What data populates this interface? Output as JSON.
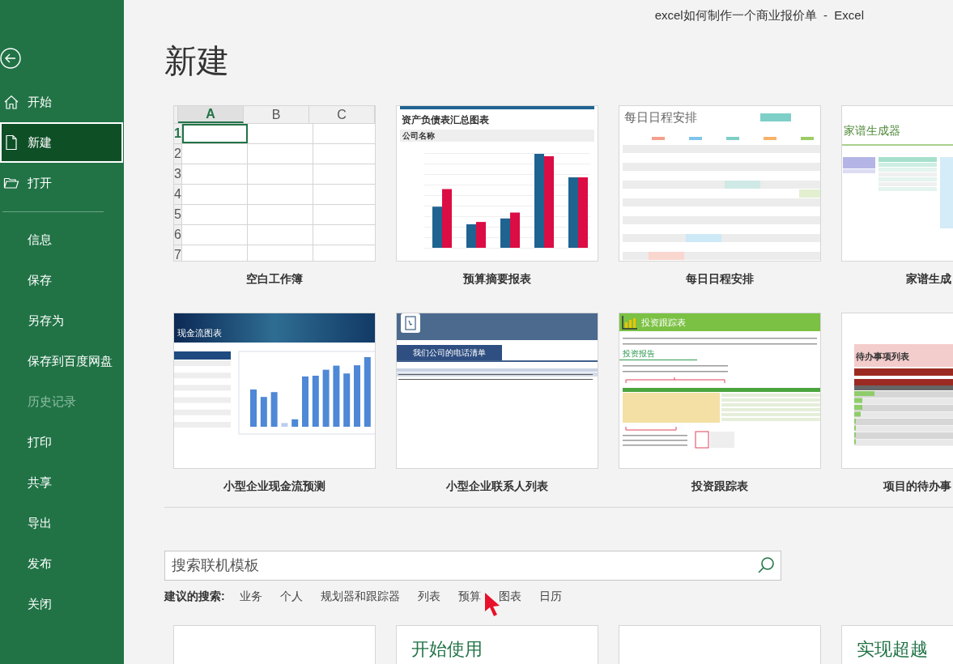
{
  "window": {
    "title": "excel如何制作一个商业报价单  -  Excel"
  },
  "sidebar": {
    "items": [
      {
        "label": "开始",
        "kind": "home",
        "selected": false,
        "disabled": false
      },
      {
        "label": "新建",
        "kind": "new",
        "selected": true,
        "disabled": false
      },
      {
        "label": "打开",
        "kind": "open",
        "selected": false,
        "disabled": false
      },
      {
        "kind": "separator"
      },
      {
        "label": "信息",
        "kind": "plain",
        "selected": false,
        "disabled": false
      },
      {
        "label": "保存",
        "kind": "plain",
        "selected": false,
        "disabled": false
      },
      {
        "label": "另存为",
        "kind": "plain",
        "selected": false,
        "disabled": false
      },
      {
        "label": "保存到百度网盘",
        "kind": "plain",
        "selected": false,
        "disabled": false
      },
      {
        "label": "历史记录",
        "kind": "plain",
        "selected": false,
        "disabled": true
      },
      {
        "label": "打印",
        "kind": "plain",
        "selected": false,
        "disabled": false
      },
      {
        "label": "共享",
        "kind": "plain",
        "selected": false,
        "disabled": false
      },
      {
        "label": "导出",
        "kind": "plain",
        "selected": false,
        "disabled": false
      },
      {
        "label": "发布",
        "kind": "plain",
        "selected": false,
        "disabled": false
      },
      {
        "label": "关闭",
        "kind": "plain",
        "selected": false,
        "disabled": false
      }
    ]
  },
  "heading": "新建",
  "templates": [
    {
      "kind": "blank",
      "label": "空白工作簿",
      "columns": [
        {
          "label": "A",
          "selected": true
        },
        {
          "label": "B",
          "selected": false
        },
        {
          "label": "C",
          "selected": false
        }
      ],
      "rows": [
        {
          "label": "1",
          "selected": true
        },
        {
          "label": "2",
          "selected": false
        },
        {
          "label": "3",
          "selected": false
        },
        {
          "label": "4",
          "selected": false
        },
        {
          "label": "5",
          "selected": false
        },
        {
          "label": "6",
          "selected": false
        },
        {
          "label": "7",
          "selected": false
        }
      ]
    },
    {
      "kind": "budget",
      "label": "预算摘要报表",
      "title": "资产负债表汇总图表",
      "subtitle": "公司名称"
    },
    {
      "kind": "schedule",
      "label": "每日日程安排",
      "title": "每日日程安排"
    },
    {
      "kind": "family",
      "label": "家谱生成",
      "title": "家谱生成器"
    },
    {
      "kind": "cashflow",
      "label": "小型企业现金流预测",
      "title": "现金流图表"
    },
    {
      "kind": "contacts",
      "label": "小型企业联系人列表",
      "title": "我们公司的电话清单"
    },
    {
      "kind": "investment",
      "label": "投资跟踪表",
      "title": "投资跟踪表",
      "subtitle": "投资报告"
    },
    {
      "kind": "todo",
      "label": "项目的待办事",
      "title": "待办事项列表"
    }
  ],
  "search": {
    "placeholder": "搜索联机模板"
  },
  "suggestions": {
    "label": "建议的搜索:",
    "items": [
      "业务",
      "个人",
      "规划器和跟踪器",
      "列表",
      "预算",
      "图表",
      "日历"
    ]
  },
  "more_templates": [
    {
      "kind": "empty"
    },
    {
      "kind": "titled",
      "title": "开始使用"
    },
    {
      "kind": "empty"
    },
    {
      "kind": "titled",
      "title": "实现超越"
    }
  ]
}
